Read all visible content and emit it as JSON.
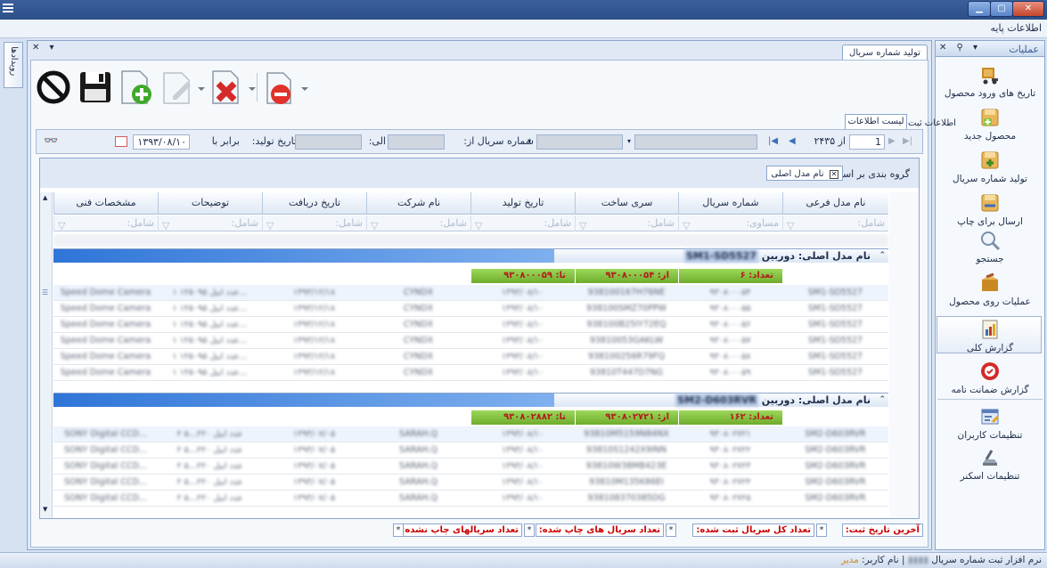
{
  "menu": {
    "base_info": "اطلاعات پایه"
  },
  "left_strip": {
    "tab_label": "رویدادها"
  },
  "ops": {
    "title": "عملیات",
    "items": [
      {
        "label": "تاریخ های ورود محصول",
        "icon": "truck-icon"
      },
      {
        "label": "محصول جدید",
        "icon": "new-product-icon"
      },
      {
        "label": "تولید شماره سریال",
        "icon": "serial-generate-icon"
      },
      {
        "label": "ارسال برای چاپ",
        "icon": "print-send-icon"
      },
      {
        "label": "جستجو",
        "icon": "search-icon"
      },
      {
        "label": "عملیات روی محصول",
        "icon": "product-ops-icon"
      },
      {
        "label": "گزارش کلی",
        "icon": "report-icon"
      },
      {
        "label": "گزارش ضمانت نامه",
        "icon": "warranty-icon"
      },
      {
        "label": "تنظیمات کاربران",
        "icon": "users-settings-icon"
      },
      {
        "label": "تنظیمات اسکنر",
        "icon": "scanner-icon"
      }
    ]
  },
  "doc": {
    "tab_title": "تولید شماره سریال"
  },
  "tabs": {
    "list": "لیست اطلاعات",
    "register": "اطلاعات ثبت"
  },
  "filter": {
    "page_current": "1",
    "page_total": "از ۲۴۳۵",
    "serial_label": "شماره سریال از:",
    "to_label": "الی:",
    "date_label": "تاریخ تولید:",
    "date_op": "برابر با",
    "date_value": "۱۳۹۳/۰۸/۱۰"
  },
  "groupby": {
    "label": "گروه بندی بر اساس",
    "chip": "نام مدل اصلی"
  },
  "columns": [
    "نام مدل فرعی",
    "شماره سریال",
    "سری ساخت",
    "تاریخ تولید",
    "نام شرکت",
    "تاریخ دریافت",
    "توضیحات",
    "مشخصات فنی"
  ],
  "filter_row": {
    "contains": "شامل:",
    "equals": "مساوی:"
  },
  "group1": {
    "title": "نام مدل اصلی: دوربین",
    "model": "SM1-SD5527",
    "count": "تعداد: ۶",
    "from": "از: ۹۳۰۸۰۰۰۵۴",
    "to": "تا: ۹۳۰۸۰۰۰۵۹",
    "rows": [
      [
        "SM1-SD5527",
        "۹۳۰۸۰۰۰۵۴",
        "938100167H76NE",
        "۱۳۹۳/۰۸/۱۰",
        "CYNDX",
        "۱۳۹۳/۱۲/۱۸",
        "۱ عدد ابیل ۱۲۵۰۹۵...",
        "Speed Dome Camera"
      ],
      [
        "SM1-SD5527",
        "۹۳۰۸۰۰۰۵۵",
        "938100SMZ70PPW",
        "۱۳۹۳/۰۸/۱۰",
        "CYNDX",
        "۱۳۹۳/۱۲/۱۸",
        "۱ عدد ابیل ۱۲۵۰۹۵...",
        "Speed Dome Camera"
      ],
      [
        "SM1-SD5527",
        "۹۳۰۸۰۰۰۵۶",
        "938100B25IY72EQ",
        "۱۳۹۳/۰۸/۱۰",
        "CYNDX",
        "۱۳۹۳/۱۲/۱۸",
        "۱ عدد ابیل ۱۲۵۰۹۵...",
        "Speed Dome Camera"
      ],
      [
        "SM1-SD5527",
        "۹۳۰۸۰۰۰۵۷",
        "93810053GAKLW",
        "۱۳۹۳/۰۸/۱۰",
        "CYNDX",
        "۱۳۹۳/۱۲/۱۸",
        "۱ عدد ابیل ۱۲۵۰۹۵...",
        "Speed Dome Camera"
      ],
      [
        "SM1-SD5527",
        "۹۳۰۸۰۰۰۵۸",
        "938100256R79FQ",
        "۱۳۹۳/۰۸/۱۰",
        "CYNDX",
        "۱۳۹۳/۱۲/۱۸",
        "۱ عدد ابیل ۱۲۵۰۹۵...",
        "Speed Dome Camera"
      ],
      [
        "SM1-SD5527",
        "۹۳۰۸۰۰۰۵۹",
        "93810T447D7NG",
        "۱۳۹۳/۰۸/۱۰",
        "CYNDX",
        "۱۳۹۳/۱۲/۱۸",
        "۱ عدد ابیل ۱۲۵۰۹۵...",
        "Speed Dome Camera"
      ]
    ]
  },
  "group2": {
    "title": "نام مدل اصلی: دوربین",
    "model": "SM2-D603RVR",
    "count": "تعداد: ۱۶۲",
    "from": "از: ۹۳۰۸۰۲۷۲۱",
    "to": "تا: ۹۳۰۸۰۲۸۸۲",
    "rows": [
      [
        "SM2-D603RVR",
        "۹۳۰۸۰۲۷۲۱",
        "93810M5159N84NX",
        "۱۳۹۳/۰۸/۱۰",
        "SARAH.Q",
        "۱۳۹۳/۰۷/۰۵",
        "۲ عدد ابیل ۲۲۰...۵",
        "SONY Digital CCD..."
      ],
      [
        "SM2-D603RVR",
        "۹۳۰۸۰۲۷۲۲",
        "93810S1242X9INN",
        "۱۳۹۳/۰۸/۱۰",
        "SARAH.Q",
        "۱۳۹۳/۰۷/۰۵",
        "۲ عدد ابیل ۲۲۰...۵",
        "SONY Digital CCD..."
      ],
      [
        "SM2-D603RVR",
        "۹۳۰۸۰۲۷۲۳",
        "93810W38MB423E",
        "۱۳۹۳/۰۸/۱۰",
        "SARAH.Q",
        "۱۳۹۳/۰۷/۰۵",
        "۲ عدد ابیل ۲۲۰...۵",
        "SONY Digital CCD..."
      ],
      [
        "SM2-D603RVR",
        "۹۳۰۸۰۲۷۲۴",
        "93810M135K86EI",
        "۱۳۹۳/۰۸/۱۰",
        "SARAH.Q",
        "۱۳۹۳/۰۷/۰۵",
        "۲ عدد ابیل ۲۲۰...۵",
        "SONY Digital CCD..."
      ],
      [
        "SM2-D603RVR",
        "۹۳۰۸۰۲۷۲۵",
        "938108370385DG",
        "۱۳۹۳/۰۸/۱۰",
        "SARAH.Q",
        "۱۳۹۳/۰۷/۰۵",
        "۲ عدد ابیل ۲۲۰...۵",
        "SONY Digital CCD..."
      ]
    ]
  },
  "summary": {
    "last_date": "آخرین تاریخ ثبت:",
    "total": "تعداد کل سریال ثبت شده:",
    "printed": "تعداد سریال های چاپ شده:",
    "not_printed": "تعداد سریالهای چاپ نشده:",
    "star": "*"
  },
  "status": {
    "app_name": "نرم افزار ثبت شماره سریال",
    "sep": "|",
    "user_label": "نام کاربر:",
    "user_value": "مدیر"
  }
}
